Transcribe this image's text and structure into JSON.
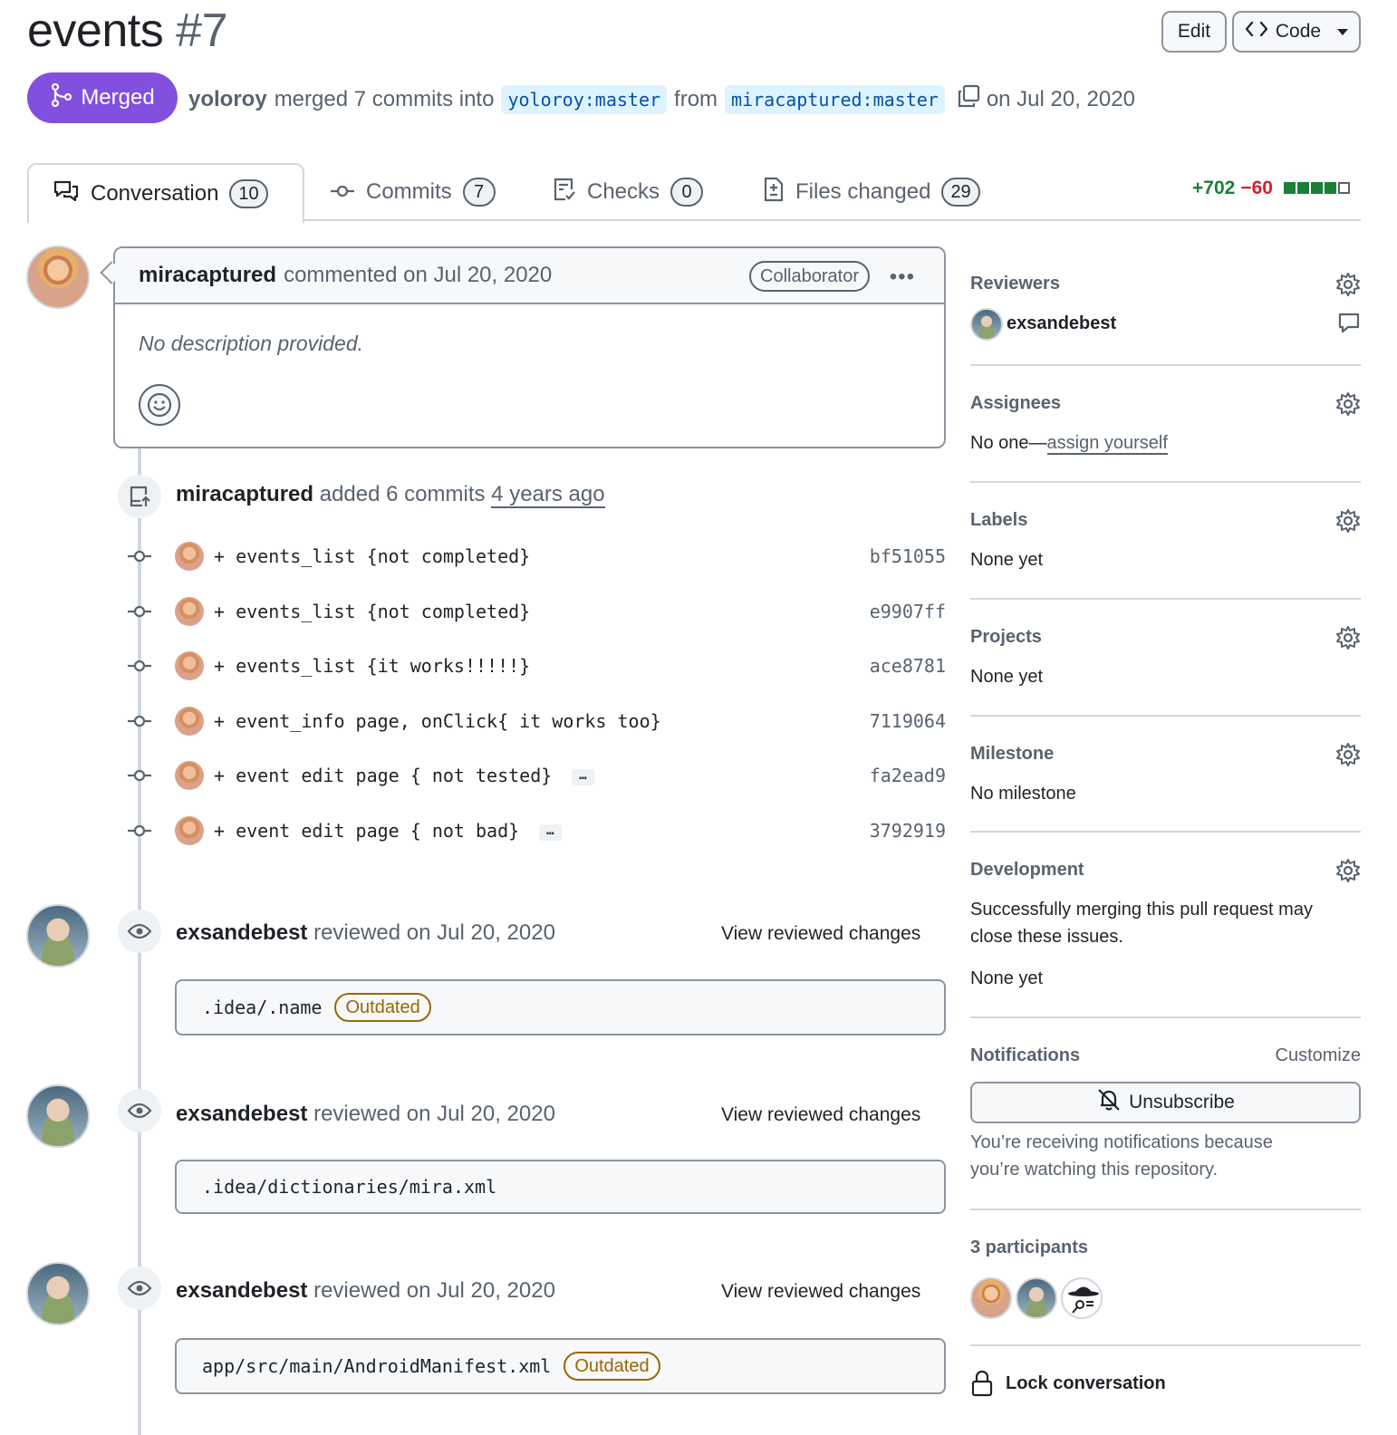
{
  "header": {
    "title": "events",
    "number": "#7",
    "edit_label": "Edit",
    "code_label": "Code"
  },
  "status": {
    "state": "Merged",
    "user": "yoloroy",
    "merged_text": "merged 7 commits into",
    "base_branch": "yoloroy:master",
    "from_text": "from",
    "head_branch": "miracaptured:master",
    "date_text": "on Jul 20, 2020"
  },
  "tabs": [
    {
      "label": "Conversation",
      "count": "10"
    },
    {
      "label": "Commits",
      "count": "7"
    },
    {
      "label": "Checks",
      "count": "0"
    },
    {
      "label": "Files changed",
      "count": "29"
    }
  ],
  "diffstat": {
    "additions": "+702",
    "deletions": "−60"
  },
  "comment": {
    "author": "miracaptured",
    "meta": "commented on Jul 20, 2020",
    "role": "Collaborator",
    "body": "No description provided."
  },
  "commits_event": {
    "author": "miracaptured",
    "text": "added 6 commits",
    "time": "4 years ago"
  },
  "commits": [
    {
      "message": "+ events_list {not completed}",
      "sha": "bf51055",
      "has_more": false
    },
    {
      "message": "+ events_list {not completed}",
      "sha": "e9907ff",
      "has_more": false
    },
    {
      "message": "+ events_list {it works!!!!!}",
      "sha": "ace8781",
      "has_more": false
    },
    {
      "message": "+ event_info page, onClick{ it works too}",
      "sha": "7119064",
      "has_more": false
    },
    {
      "message": "+ event edit page { not tested}",
      "sha": "fa2ead9",
      "has_more": true
    },
    {
      "message": "+ event edit page { not bad}",
      "sha": "3792919",
      "has_more": true
    }
  ],
  "reviews": [
    {
      "author": "exsandebest",
      "meta": "reviewed on Jul 20, 2020",
      "link": "View reviewed changes",
      "file": ".idea/.name",
      "badge": "Outdated"
    },
    {
      "author": "exsandebest",
      "meta": "reviewed on Jul 20, 2020",
      "link": "View reviewed changes",
      "file": ".idea/dictionaries/mira.xml",
      "badge": ""
    },
    {
      "author": "exsandebest",
      "meta": "reviewed on Jul 20, 2020",
      "link": "View reviewed changes",
      "file": "app/src/main/AndroidManifest.xml",
      "badge": "Outdated"
    }
  ],
  "sidebar": {
    "reviewers_title": "Reviewers",
    "reviewer": "exsandebest",
    "assignees_title": "Assignees",
    "assignees_prefix": "No one—",
    "assignees_link": "assign yourself",
    "labels_title": "Labels",
    "labels_value": "None yet",
    "projects_title": "Projects",
    "projects_value": "None yet",
    "milestone_title": "Milestone",
    "milestone_value": "No milestone",
    "development_title": "Development",
    "development_line1": "Successfully merging this pull request may",
    "development_line2": "close these issues.",
    "development_value": "None yet",
    "notifications_title": "Notifications",
    "customize_label": "Customize",
    "unsubscribe_label": "Unsubscribe",
    "notif_line1": "You’re receiving notifications because",
    "notif_line2": "you’re watching this repository.",
    "participants_title": "3 participants",
    "lock_label": "Lock conversation"
  },
  "colors": {
    "merged": "#8250df",
    "additions": "#1a7f37",
    "deletions": "#cf222e",
    "outdated": "#9a6700",
    "branch_bg": "#ddf4ff"
  }
}
